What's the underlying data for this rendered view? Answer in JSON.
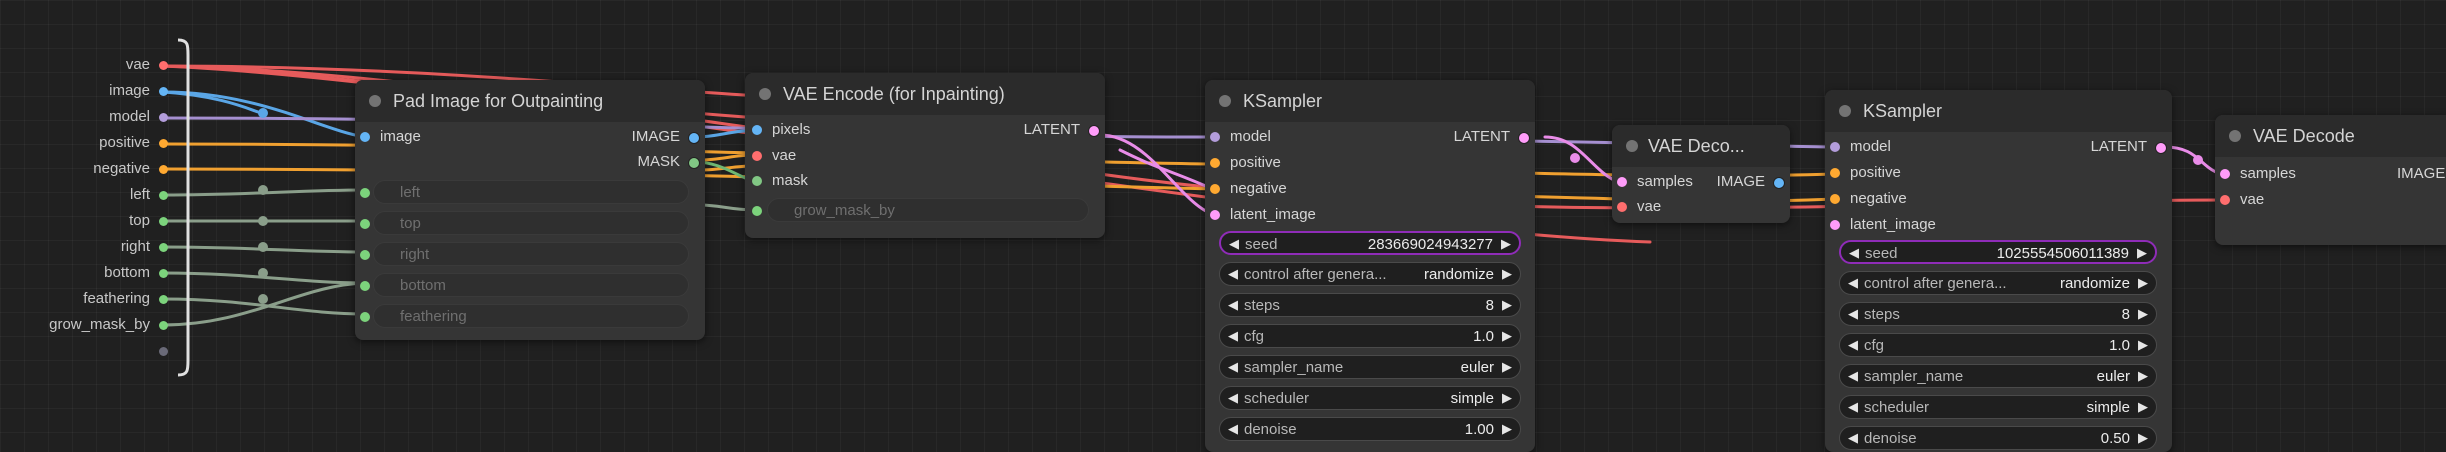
{
  "colors": {
    "vae": "#ff6e6e",
    "image": "#64b5f6",
    "model": "#b39ddb",
    "conditioning": "#ffa931",
    "int": "#7cd37c",
    "latent": "#ff9cf9",
    "mask": "#81c784",
    "selected": "#8f2cb8"
  },
  "reroute": {
    "labels": [
      "vae",
      "image",
      "model",
      "positive",
      "negative",
      "left",
      "top",
      "right",
      "bottom",
      "feathering",
      "grow_mask_by"
    ]
  },
  "pad_node": {
    "title": "Pad Image for Outpainting",
    "input": "image",
    "outputs": [
      "IMAGE",
      "MASK"
    ],
    "widgets": [
      "left",
      "top",
      "right",
      "bottom",
      "feathering"
    ]
  },
  "vae_encode": {
    "title": "VAE Encode (for Inpainting)",
    "inputs": [
      "pixels",
      "vae",
      "mask"
    ],
    "output": "LATENT",
    "widget": "grow_mask_by"
  },
  "ksampler1": {
    "title": "KSampler",
    "inputs": [
      "model",
      "positive",
      "negative",
      "latent_image"
    ],
    "output": "LATENT",
    "widgets": [
      {
        "label": "seed",
        "value": "283669024943277"
      },
      {
        "label": "control after genera...",
        "value": "randomize"
      },
      {
        "label": "steps",
        "value": "8"
      },
      {
        "label": "cfg",
        "value": "1.0"
      },
      {
        "label": "sampler_name",
        "value": "euler"
      },
      {
        "label": "scheduler",
        "value": "simple"
      },
      {
        "label": "denoise",
        "value": "1.00"
      }
    ]
  },
  "vae_decode_small": {
    "title": "VAE Deco...",
    "inputs": [
      "samples",
      "vae"
    ],
    "output": "IMAGE"
  },
  "ksampler2": {
    "title": "KSampler",
    "inputs": [
      "model",
      "positive",
      "negative",
      "latent_image"
    ],
    "output": "LATENT",
    "widgets": [
      {
        "label": "seed",
        "value": "1025554506011389"
      },
      {
        "label": "control after genera...",
        "value": "randomize"
      },
      {
        "label": "steps",
        "value": "8"
      },
      {
        "label": "cfg",
        "value": "1.0"
      },
      {
        "label": "sampler_name",
        "value": "euler"
      },
      {
        "label": "scheduler",
        "value": "simple"
      },
      {
        "label": "denoise",
        "value": "0.50"
      }
    ]
  },
  "vae_decode": {
    "title": "VAE Decode",
    "inputs": [
      "samples",
      "vae"
    ],
    "output": "IMAGE"
  }
}
